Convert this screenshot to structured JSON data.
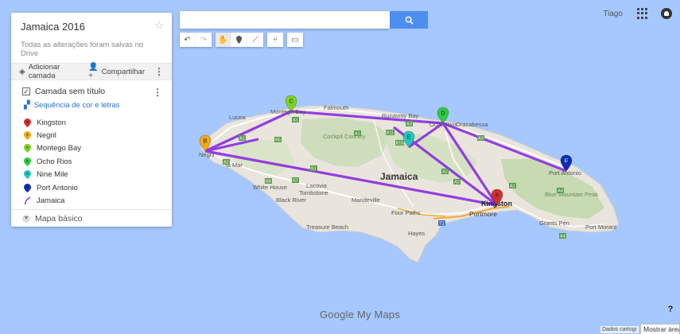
{
  "map": {
    "colors": {
      "sea": "#a6c8ff",
      "land": "#e9e5dc",
      "forest": "#c9dcb6",
      "route": "#8a2be2",
      "road_major": "#f6a73c",
      "road": "#ffffff"
    },
    "island_label": "Jamaica",
    "places": [
      {
        "id": "lucea",
        "label": "Lucea"
      },
      {
        "id": "montego",
        "label": "Montego Bay"
      },
      {
        "id": "falmouth",
        "label": "Falmouth"
      },
      {
        "id": "runaway",
        "label": "Runaway Bay"
      },
      {
        "id": "ochorios",
        "label": "Ocho Rios"
      },
      {
        "id": "oracabessa",
        "label": "Oracabessa"
      },
      {
        "id": "cockpit",
        "label": "Cockpit Country"
      },
      {
        "id": "negril",
        "label": "Negril"
      },
      {
        "id": "savlamar",
        "label": "la Mar"
      },
      {
        "id": "whitehouse",
        "label": "White House"
      },
      {
        "id": "lacovia",
        "label": "Lacovia"
      },
      {
        "id": "tombstone",
        "label": "Tombstone"
      },
      {
        "id": "blackriver",
        "label": "Black River"
      },
      {
        "id": "mandeville",
        "label": "Mandeville"
      },
      {
        "id": "fourpaths",
        "label": "Four Paths"
      },
      {
        "id": "hayes",
        "label": "Hayes"
      },
      {
        "id": "treasure",
        "label": "Treasure Beach"
      },
      {
        "id": "kingston",
        "label": "Kingston"
      },
      {
        "id": "portmore",
        "label": "Portmore"
      },
      {
        "id": "portantonio",
        "label": "Port Antonio"
      },
      {
        "id": "bluemountain",
        "label": "Blue Mountain Peak"
      },
      {
        "id": "grantspen",
        "label": "Grants Pen"
      },
      {
        "id": "portmorant",
        "label": "Port Morant"
      }
    ],
    "road_shields": [
      "A1",
      "B11",
      "A1",
      "B15",
      "A3",
      "B5",
      "B8",
      "B7",
      "B1",
      "A2",
      "A2",
      "A1",
      "A4",
      "A4",
      "T1",
      "A2",
      "A1",
      "A3"
    ],
    "markers": [
      {
        "letter": "A",
        "name": "Kingston",
        "color": "#d32f2f"
      },
      {
        "letter": "B",
        "name": "Negril",
        "color": "#f3a817"
      },
      {
        "letter": "C",
        "name": "Montego Bay",
        "color": "#7ed321"
      },
      {
        "letter": "D",
        "name": "Ocho Rios",
        "color": "#2ecc40"
      },
      {
        "letter": "E",
        "name": "Nine Mile",
        "color": "#1fc8c0"
      },
      {
        "letter": "F",
        "name": "Port Antonio",
        "color": "#0d2fb5"
      }
    ]
  },
  "panel": {
    "title": "Jamaica 2016",
    "saved_status": "Todas as alterações foram salvas no Drive",
    "add_layer": "Adicionar camada",
    "share": "Compartilhar",
    "layer_name": "Camada sem título",
    "style_link": "Sequência de cor e letras",
    "items": [
      {
        "label": "Kingston",
        "color": "#d32f2f"
      },
      {
        "label": "Negril",
        "color": "#f3a817"
      },
      {
        "label": "Montego Bay",
        "color": "#7ed321"
      },
      {
        "label": "Ocho Rios",
        "color": "#2ecc40"
      },
      {
        "label": "Nine Mile",
        "color": "#1fc8c0"
      },
      {
        "label": "Port Antonio",
        "color": "#0d2fb5"
      },
      {
        "label": "Jamaica",
        "color": "#8a2be2",
        "icon": "route-line-icon"
      }
    ],
    "basemap": "Mapa básico"
  },
  "search": {
    "value": "",
    "placeholder": ""
  },
  "toolbar": {
    "icons": [
      "undo-icon",
      "redo-icon",
      "hand-icon",
      "marker-icon",
      "draw-line-icon",
      "directions-icon",
      "ruler-icon"
    ]
  },
  "topbar": {
    "user": "Tiago"
  },
  "footer": {
    "logo_google": "Google",
    "logo_mymaps": "My Maps",
    "help": "?",
    "attribution": "Dados cartogr",
    "show_area": "Mostrar área c"
  }
}
